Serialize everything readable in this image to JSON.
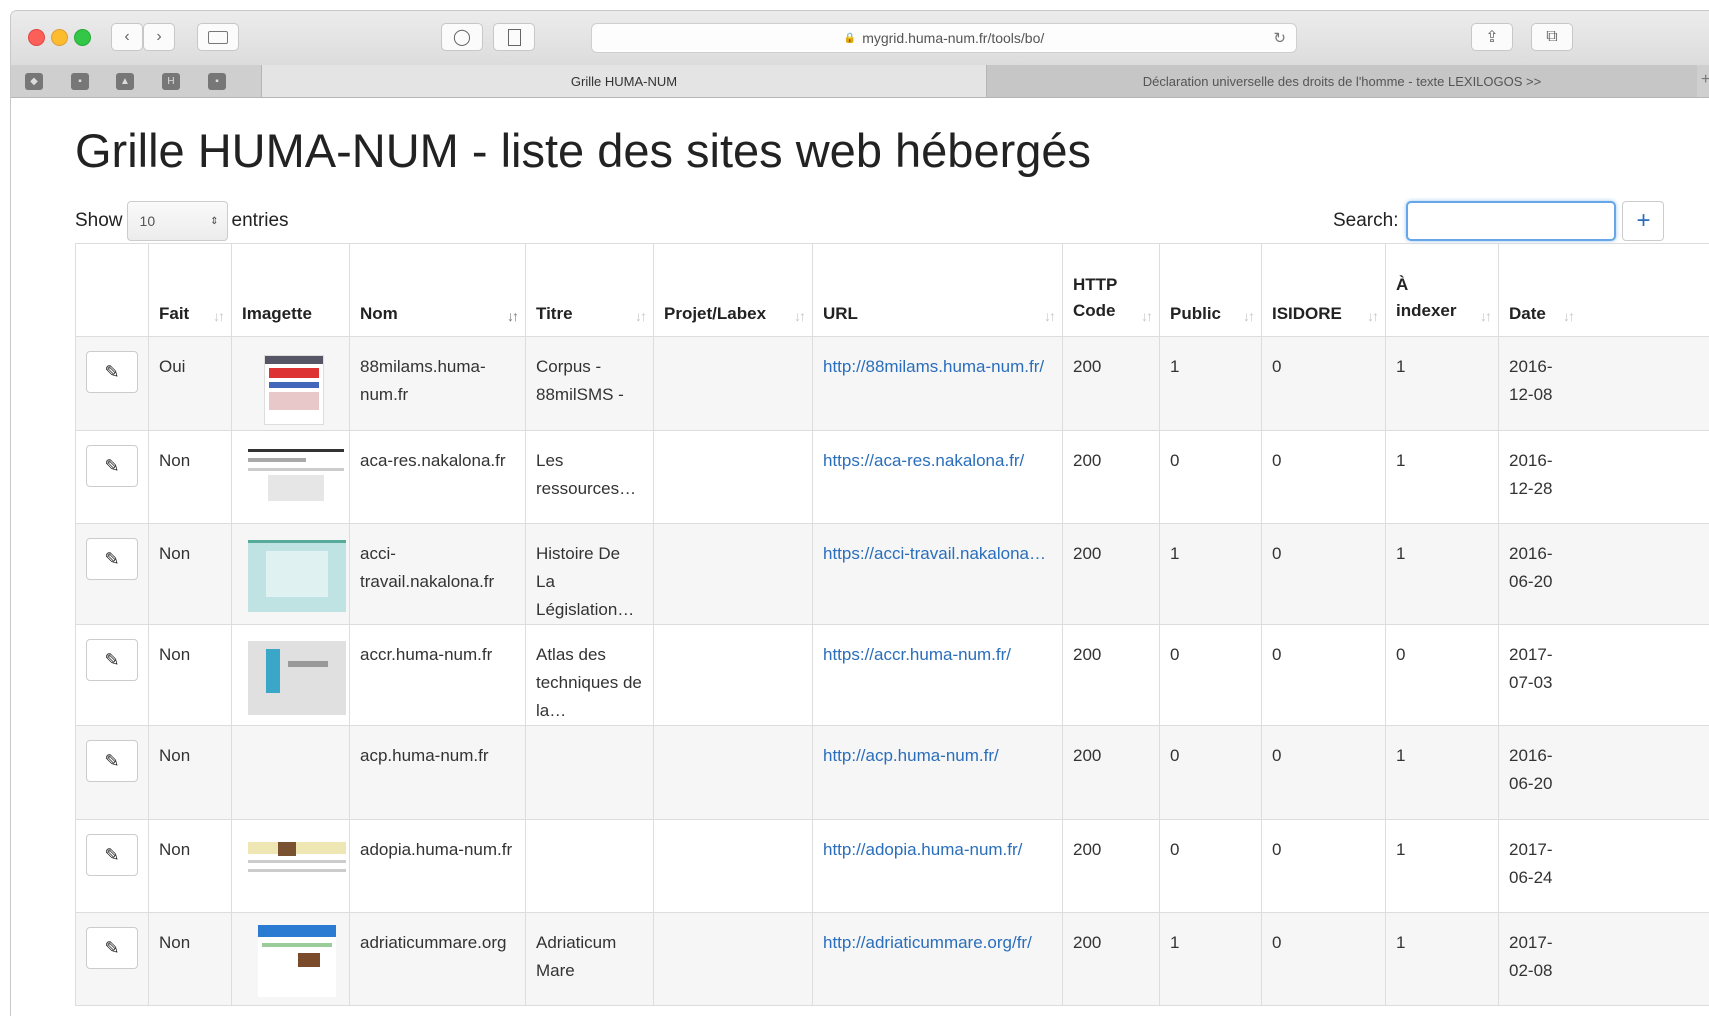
{
  "browser": {
    "address": "mygrid.huma-num.fr/tools/bo/",
    "tabs": [
      {
        "label": "Grille HUMA-NUM"
      },
      {
        "label": "Déclaration universelle des droits de l'homme - texte LEXILOGOS >>"
      }
    ]
  },
  "page": {
    "title": "Grille HUMA-NUM - liste des sites web hébergés",
    "show_label": "Show",
    "page_size": "10",
    "entries_label": "entries",
    "search_label": "Search:",
    "search_value": "",
    "add_label": "+"
  },
  "table": {
    "columns": [
      "",
      "Fait",
      "Imagette",
      "Nom",
      "Titre",
      "Projet/Labex",
      "URL",
      "HTTP Code",
      "Public",
      "ISIDORE",
      "À indexer",
      "Date"
    ],
    "sort_icon": "↓↑",
    "rows": [
      {
        "fait": "Oui",
        "thumb": "colorful",
        "nom": "88milams.huma-num.fr",
        "titre": "Corpus - 88milSMS -",
        "projet": "",
        "url": "http://88milams.huma-num.fr/",
        "http": "200",
        "public": "1",
        "isidore": "0",
        "indexer": "1",
        "date": "2016-12-08"
      },
      {
        "fait": "Non",
        "thumb": "doc",
        "nom": "aca-res.nakalona.fr",
        "titre": "Les ressources…",
        "projet": "",
        "url": "https://aca-res.nakalona.fr/",
        "http": "200",
        "public": "0",
        "isidore": "0",
        "indexer": "1",
        "date": "2016-12-28"
      },
      {
        "fait": "Non",
        "thumb": "teal",
        "nom": "acci-travail.nakalona.fr",
        "titre": "Histoire De La Législation…",
        "projet": "",
        "url": "https://acci-travail.nakalona…",
        "http": "200",
        "public": "1",
        "isidore": "0",
        "indexer": "1",
        "date": "2016-06-20"
      },
      {
        "fait": "Non",
        "thumb": "grey",
        "nom": "accr.huma-num.fr",
        "titre": "Atlas des techniques de la…",
        "projet": "",
        "url": "https://accr.huma-num.fr/",
        "http": "200",
        "public": "0",
        "isidore": "0",
        "indexer": "0",
        "date": "2017-07-03"
      },
      {
        "fait": "Non",
        "thumb": "none",
        "nom": "acp.huma-num.fr",
        "titre": "",
        "projet": "",
        "url": "http://acp.huma-num.fr/",
        "http": "200",
        "public": "0",
        "isidore": "0",
        "indexer": "1",
        "date": "2016-06-20"
      },
      {
        "fait": "Non",
        "thumb": "yellow",
        "nom": "adopia.huma-num.fr",
        "titre": "",
        "projet": "",
        "url": "http://adopia.huma-num.fr/",
        "http": "200",
        "public": "0",
        "isidore": "0",
        "indexer": "1",
        "date": "2017-06-24"
      },
      {
        "fait": "Non",
        "thumb": "blue",
        "nom": "adriaticummare.org",
        "titre": "Adriaticum Mare",
        "projet": "",
        "url": "http://adriaticummare.org/fr/",
        "http": "200",
        "public": "1",
        "isidore": "0",
        "indexer": "1",
        "date": "2017-02-08"
      }
    ]
  }
}
